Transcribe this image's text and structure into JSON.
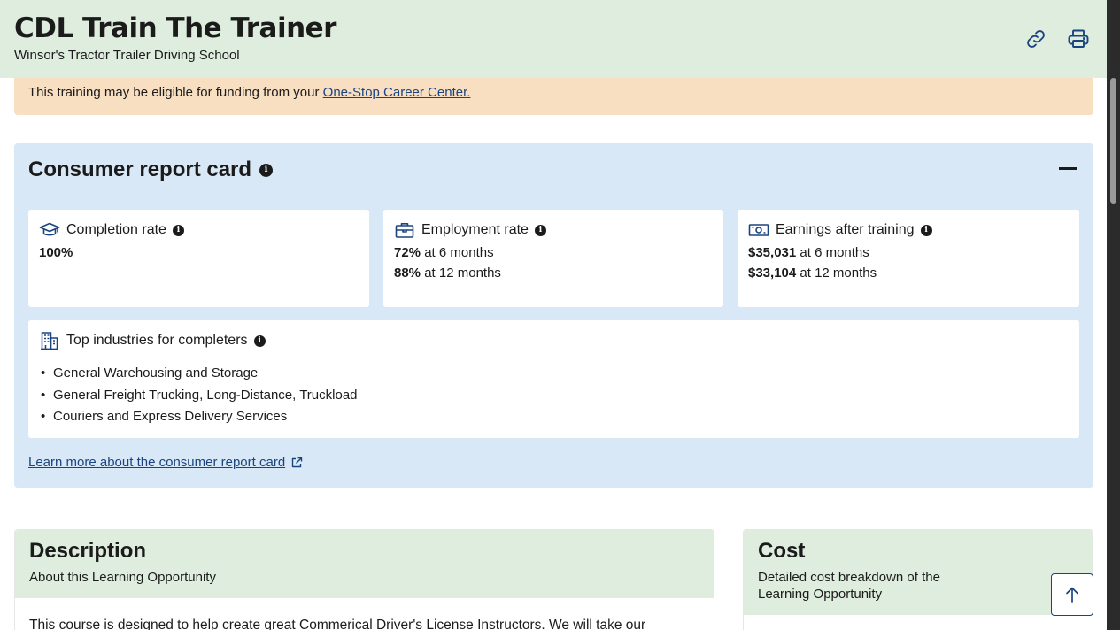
{
  "header": {
    "title": "CDL Train The Trainer",
    "subtitle": "Winsor's Tractor Trailer Driving School",
    "icons": [
      "link-icon",
      "print-icon"
    ]
  },
  "funding": {
    "text": "This training may be eligible for funding from your ",
    "link": "One-Stop Career Center."
  },
  "report_card": {
    "title": "Consumer report card",
    "collapse_icon": "minus-icon",
    "completion": {
      "label": "Completion rate",
      "icon": "graduation-cap-icon",
      "value": "100%"
    },
    "employment": {
      "label": "Employment rate",
      "icon": "briefcase-icon",
      "rows": [
        {
          "value": "72%",
          "suffix": " at 6 months"
        },
        {
          "value": "88%",
          "suffix": " at 12 months"
        }
      ]
    },
    "earnings": {
      "label": "Earnings after training",
      "icon": "money-icon",
      "rows": [
        {
          "value": "$35,031",
          "suffix": " at 6 months"
        },
        {
          "value": "$33,104",
          "suffix": " at 12 months"
        }
      ]
    },
    "industries": {
      "label": "Top industries for completers",
      "icon": "building-icon",
      "items": [
        "General Warehousing and Storage",
        "General Freight Trucking, Long-Distance, Truckload",
        "Couriers and Express Delivery Services"
      ]
    },
    "learn_more": "Learn more about the consumer report card"
  },
  "description": {
    "title": "Description",
    "subtitle": "About this Learning Opportunity",
    "body": "This course is designed to help create great Commerical Driver's License Instructors. We will take our"
  },
  "cost": {
    "title": "Cost",
    "subtitle": "Detailed cost breakdown of the Learning Opportunity"
  },
  "colors": {
    "header_bg": "#deeddd",
    "banner_bg": "#f8dfc2",
    "panel_bg": "#d9e8f6",
    "link": "#1a4480"
  }
}
